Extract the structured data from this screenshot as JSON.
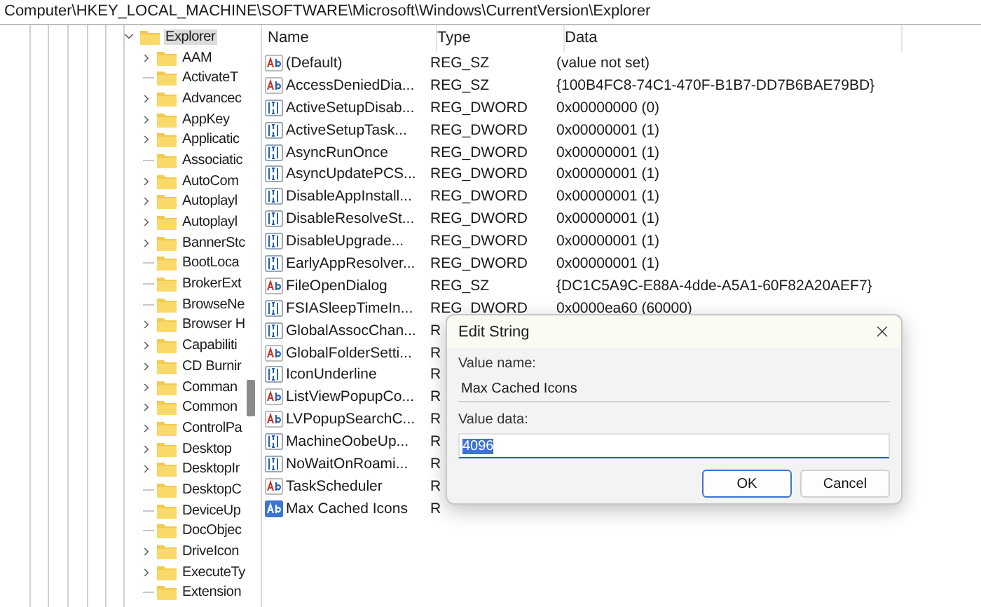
{
  "address_bar": {
    "path": "Computer\\HKEY_LOCAL_MACHINE\\SOFTWARE\\Microsoft\\Windows\\CurrentVersion\\Explorer"
  },
  "tree": {
    "label": "Explorer",
    "expanded": true,
    "selected": true,
    "children": [
      {
        "label": "AAM",
        "expandable": true
      },
      {
        "label": "ActivateT",
        "expandable": false
      },
      {
        "label": "Advancec",
        "expandable": true
      },
      {
        "label": "AppKey",
        "expandable": true
      },
      {
        "label": "Applicatic",
        "expandable": true
      },
      {
        "label": "Associatic",
        "expandable": false
      },
      {
        "label": "AutoCom",
        "expandable": true
      },
      {
        "label": "Autoplayl",
        "expandable": true
      },
      {
        "label": "Autoplayl",
        "expandable": true
      },
      {
        "label": "BannerStc",
        "expandable": true
      },
      {
        "label": "BootLoca",
        "expandable": false
      },
      {
        "label": "BrokerExt",
        "expandable": false
      },
      {
        "label": "BrowseNe",
        "expandable": false
      },
      {
        "label": "Browser H",
        "expandable": true
      },
      {
        "label": "Capabiliti",
        "expandable": true
      },
      {
        "label": "CD Burnir",
        "expandable": true
      },
      {
        "label": "Comman",
        "expandable": true
      },
      {
        "label": "Common",
        "expandable": true
      },
      {
        "label": "ControlPa",
        "expandable": true
      },
      {
        "label": "Desktop",
        "expandable": true
      },
      {
        "label": "DesktopIr",
        "expandable": true
      },
      {
        "label": "DesktopC",
        "expandable": false
      },
      {
        "label": "DeviceUp",
        "expandable": false
      },
      {
        "label": "DocObjec",
        "expandable": false
      },
      {
        "label": "DriveIcon",
        "expandable": true
      },
      {
        "label": "ExecuteTy",
        "expandable": true
      },
      {
        "label": "Extension",
        "expandable": false
      }
    ]
  },
  "values": {
    "columns": [
      "Name",
      "Type",
      "Data"
    ],
    "rows": [
      {
        "kind": "string",
        "name": "(Default)",
        "type": "REG_SZ",
        "data": "(value not set)",
        "selected": false
      },
      {
        "kind": "string",
        "name": "AccessDeniedDia...",
        "type": "REG_SZ",
        "data": "{100B4FC8-74C1-470F-B1B7-DD7B6BAE79BD}",
        "selected": false
      },
      {
        "kind": "dword",
        "name": "ActiveSetupDisab...",
        "type": "REG_DWORD",
        "data": "0x00000000 (0)",
        "selected": false
      },
      {
        "kind": "dword",
        "name": "ActiveSetupTask...",
        "type": "REG_DWORD",
        "data": "0x00000001 (1)",
        "selected": false
      },
      {
        "kind": "dword",
        "name": "AsyncRunOnce",
        "type": "REG_DWORD",
        "data": "0x00000001 (1)",
        "selected": false
      },
      {
        "kind": "dword",
        "name": "AsyncUpdatePCS...",
        "type": "REG_DWORD",
        "data": "0x00000001 (1)",
        "selected": false
      },
      {
        "kind": "dword",
        "name": "DisableAppInstall...",
        "type": "REG_DWORD",
        "data": "0x00000001 (1)",
        "selected": false
      },
      {
        "kind": "dword",
        "name": "DisableResolveSt...",
        "type": "REG_DWORD",
        "data": "0x00000001 (1)",
        "selected": false
      },
      {
        "kind": "dword",
        "name": "DisableUpgrade...",
        "type": "REG_DWORD",
        "data": "0x00000001 (1)",
        "selected": false
      },
      {
        "kind": "dword",
        "name": "EarlyAppResolver...",
        "type": "REG_DWORD",
        "data": "0x00000001 (1)",
        "selected": false
      },
      {
        "kind": "string",
        "name": "FileOpenDialog",
        "type": "REG_SZ",
        "data": "{DC1C5A9C-E88A-4dde-A5A1-60F82A20AEF7}",
        "selected": false
      },
      {
        "kind": "dword",
        "name": "FSIASleepTimeIn...",
        "type": "REG_DWORD",
        "data": "0x0000ea60 (60000)",
        "selected": false
      },
      {
        "kind": "dword",
        "name": "GlobalAssocChan...",
        "type": "R",
        "selected": false
      },
      {
        "kind": "string",
        "name": "GlobalFolderSetti...",
        "type": "R",
        "selected": false
      },
      {
        "kind": "dword",
        "name": "IconUnderline",
        "type": "R",
        "selected": false
      },
      {
        "kind": "string",
        "name": "ListViewPopupCo...",
        "type": "R",
        "selected": false
      },
      {
        "kind": "string",
        "name": "LVPopupSearchC...",
        "type": "R",
        "selected": false
      },
      {
        "kind": "dword",
        "name": "MachineOobeUp...",
        "type": "R",
        "selected": false
      },
      {
        "kind": "dword",
        "name": "NoWaitOnRoami...",
        "type": "R",
        "selected": false
      },
      {
        "kind": "string",
        "name": "TaskScheduler",
        "type": "R",
        "selected": false
      },
      {
        "kind": "string",
        "name": "Max Cached Icons",
        "type": "R",
        "selected": true
      }
    ]
  },
  "dialog": {
    "title": "Edit String",
    "name_label": "Value name:",
    "name_value": "Max Cached Icons",
    "data_label": "Value data:",
    "data_value": "4096",
    "data_selected": true,
    "buttons": [
      {
        "label": "OK",
        "default": true
      },
      {
        "label": "Cancel",
        "default": false
      }
    ]
  }
}
